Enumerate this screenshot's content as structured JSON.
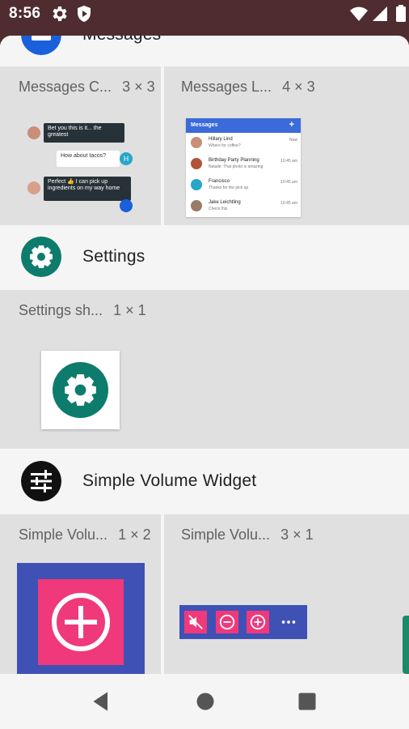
{
  "status_bar": {
    "time": "8:56"
  },
  "groups": [
    {
      "app_name": "Messages",
      "widgets": [
        {
          "name": "Messages C...",
          "size": "3 × 3"
        },
        {
          "name": "Messages L...",
          "size": "4 × 3"
        }
      ]
    },
    {
      "app_name": "Settings",
      "widgets": [
        {
          "name": "Settings sh...",
          "size": "1 × 1"
        }
      ]
    },
    {
      "app_name": "Simple Volume Widget",
      "widgets": [
        {
          "name": "Simple Volu...",
          "size": "1 × 2"
        },
        {
          "name": "Simple Volu...",
          "size": "3 × 1"
        }
      ]
    }
  ],
  "previews": {
    "messages_list": {
      "title": "Messages",
      "rows": [
        {
          "name": "Hillary Lind",
          "snippet": "Where for coffee?",
          "time": "Now"
        },
        {
          "name": "Birthday Party Planning",
          "snippet": "Nataile: That photo is amazing",
          "time": "10:45 am"
        },
        {
          "name": "Francisco",
          "snippet": "Thanks for the pick up",
          "time": "10:45 am"
        },
        {
          "name": "Jake Leichtling",
          "snippet": "Check this",
          "time": "10:45 am"
        }
      ]
    },
    "messages_convo": {
      "bubbles": [
        "Bet you this is it... the greatest",
        "How about tacos?",
        "Perfect 👍 I can pick up ingredients on my way home"
      ],
      "avatar_letter": "H"
    }
  },
  "colors": {
    "status_bar": "#4e2c2f",
    "settings_teal": "#0d7c6c",
    "messages_blue": "#1a5fdc",
    "volume_indigo": "#3f51b5",
    "volume_pink": "#f0397a"
  }
}
